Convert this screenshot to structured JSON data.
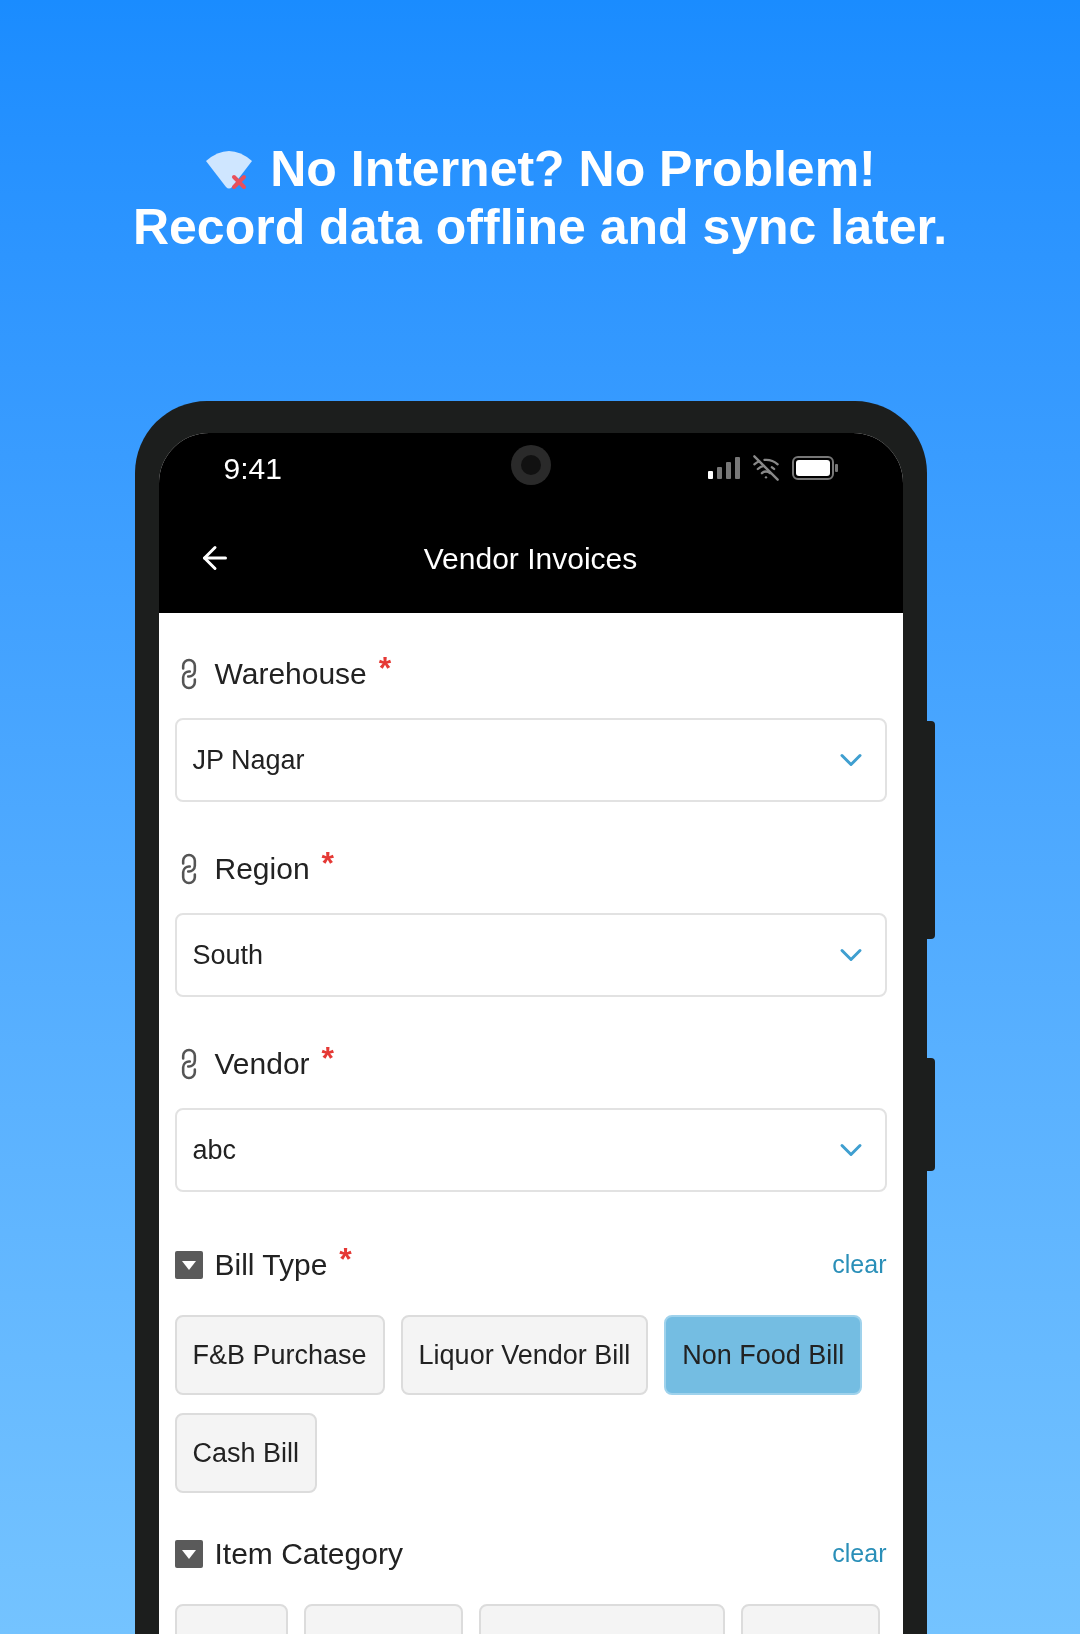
{
  "headline": {
    "line_1": "No Internet? No Problem!",
    "line_2": "Record data offline and sync later."
  },
  "status_bar": {
    "time": "9:41"
  },
  "app_bar": {
    "title": "Vendor Invoices"
  },
  "fields": [
    {
      "label": "Warehouse",
      "required_mark": "*",
      "value": "JP Nagar"
    },
    {
      "label": "Region",
      "required_mark": "*",
      "value": "South"
    },
    {
      "label": "Vendor",
      "required_mark": "*",
      "value": "abc"
    }
  ],
  "choice_groups": [
    {
      "label": "Bill Type",
      "required_mark": "*",
      "clear": "clear",
      "options": [
        {
          "label": "F&B Purchase",
          "selected": false
        },
        {
          "label": "Liquor Vendor Bill",
          "selected": false
        },
        {
          "label": "Non Food Bill",
          "selected": true
        },
        {
          "label": "Cash Bill",
          "selected": false
        }
      ]
    },
    {
      "label": "Item Category",
      "clear": "clear",
      "options": [
        {
          "selected": false
        },
        {
          "selected": false
        },
        {
          "selected": false
        },
        {
          "selected": false
        }
      ]
    }
  ]
}
